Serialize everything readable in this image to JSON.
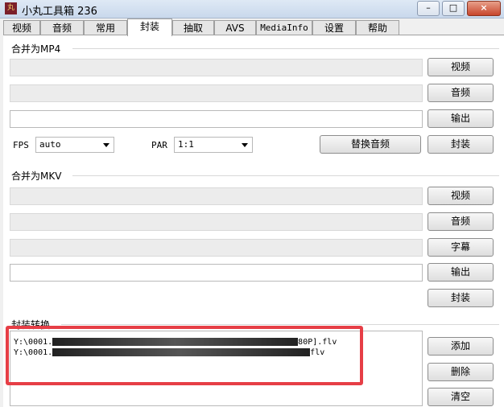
{
  "window": {
    "title": "小丸工具箱 236",
    "icon_text": "丸",
    "minimize": "–",
    "maximize": "□",
    "close": "×"
  },
  "tabs": [
    "视频",
    "音频",
    "常用",
    "封装",
    "抽取",
    "AVS",
    "MediaInfo",
    "设置",
    "帮助"
  ],
  "active_tab": "封装",
  "mp4": {
    "title": "合并为MP4",
    "video_btn": "视频",
    "audio_btn": "音频",
    "output_btn": "输出",
    "fps_label": "FPS",
    "fps_value": "auto",
    "par_label": "PAR",
    "par_value": "1:1",
    "replace_audio_btn": "替换音频",
    "mux_btn": "封装"
  },
  "mkv": {
    "title": "合并为MKV",
    "video_btn": "视频",
    "audio_btn": "音频",
    "subtitle_btn": "字幕",
    "output_btn": "输出",
    "mux_btn": "封装"
  },
  "convert": {
    "title": "封装转换",
    "files": [
      {
        "start": "Y:\\0001.",
        "end": "80P].flv"
      },
      {
        "start": "Y:\\0001.",
        "end": "flv"
      }
    ],
    "add_btn": "添加",
    "delete_btn": "删除",
    "clear_btn": "清空"
  },
  "annotation_color": "#e63e46"
}
